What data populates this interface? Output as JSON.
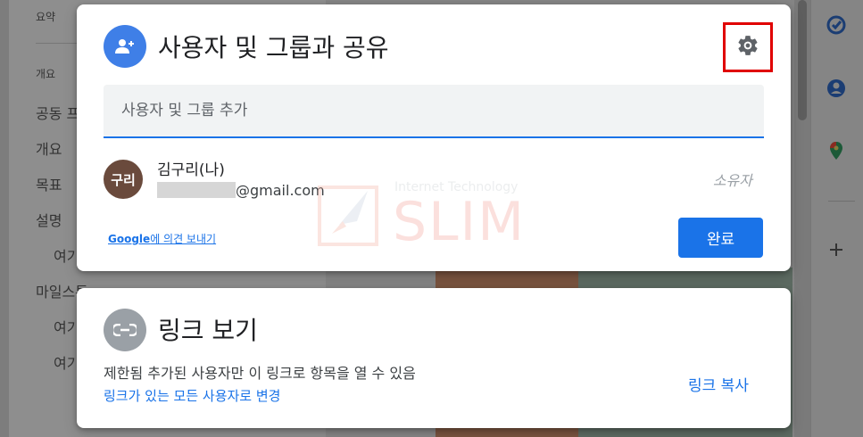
{
  "background": {
    "outline_items": [
      {
        "label": "요약"
      },
      {
        "label": "개요"
      },
      {
        "label": "공동 프"
      },
      {
        "label": "개요"
      },
      {
        "label": "목표"
      },
      {
        "label": "설명"
      },
      {
        "label": "여기"
      },
      {
        "label": "마일스톤"
      },
      {
        "label": "여기"
      },
      {
        "label": "여기"
      }
    ],
    "side_icons": [
      "tasks-icon",
      "contacts-icon",
      "maps-icon",
      "add-icon"
    ]
  },
  "share_dialog": {
    "title": "사용자 및 그룹과 공유",
    "header_icon": "person-add-icon",
    "settings_icon": "gear-icon",
    "add_input_placeholder": "사용자 및 그룹 추가",
    "person": {
      "avatar_text": "구리",
      "name": "김구리(나)",
      "email_suffix": "@gmail.com",
      "role": "소유자"
    },
    "feedback_brand": "Google",
    "feedback_rest": "에 의견 보내기",
    "done_label": "완료"
  },
  "link_dialog": {
    "title": "링크 보기",
    "header_icon": "link-icon",
    "description": "제한됨 추가된 사용자만 이 링크로 항목을 열 수 있음",
    "change_label": "링크가 있는 모든 사용자로 변경",
    "copy_label": "링크 복사"
  },
  "watermark": {
    "text": "SLIM",
    "subtext": "Internet Technology"
  },
  "colors": {
    "accent": "#1a73e8",
    "highlight_box": "#e00000",
    "owner_avatar": "#6a4a3c"
  }
}
